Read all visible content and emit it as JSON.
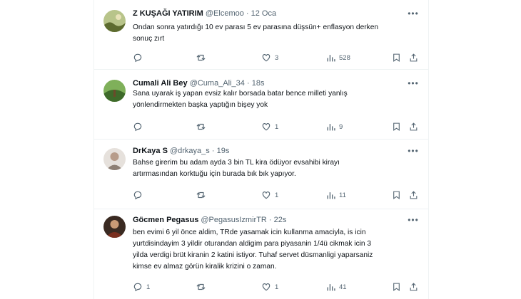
{
  "tweets": [
    {
      "name": "Z KUŞAĞI YATIRIM",
      "handle": "@Elcemoo",
      "sep": "·",
      "time": "12 Oca",
      "lines": [
        "Ondan sonra yatırdığı 10 ev parası 5 ev parasına düşsün+ enflasyon derken",
        "sonuç zırt"
      ],
      "replies": "",
      "retweets": "",
      "likes": "3",
      "views": "528",
      "avatar_color": "#8a9a5b"
    },
    {
      "name": "Cumali Ali Bey",
      "handle": "@Cuma_Ali_34",
      "sep": "·",
      "time": "18s",
      "lines": [
        "Sana uyarak iş yapan evsiz kalır borsada batar bence milleti yanlış",
        "yönlendirmekten başka yaptığın bişey yok"
      ],
      "replies": "",
      "retweets": "",
      "likes": "1",
      "views": "9",
      "avatar_color": "#4f7f3a"
    },
    {
      "name": "DrKaya S",
      "handle": "@drkaya_s",
      "sep": "·",
      "time": "19s",
      "lines": [
        "Bahse girerim bu adam ayda 3 bin TL kira ödüyor evsahibi kirayı",
        "artırmasından korktuğu için burada bık bık yapıyor."
      ],
      "replies": "",
      "retweets": "",
      "likes": "1",
      "views": "11",
      "avatar_color": "#c9c2bb"
    },
    {
      "name": "Göcmen Pegasus",
      "handle": "@PegasusIzmirTR",
      "sep": "·",
      "time": "22s",
      "lines": [
        "ben evimi 6 yil önce aldim, TRde yasamak icin kullanma amaciyla, is icin",
        "yurtdisindayim 3 yildir oturandan aldigim para piyasanin 1/4ü cikmak icin 3",
        "yilda verdigi brüt kiranin 2 katini istiyor. Tuhaf servet düsmanligi yaparsaniz",
        "kimse ev almaz görün kiralik krizini o zaman."
      ],
      "replies": "1",
      "retweets": "",
      "likes": "1",
      "views": "41",
      "avatar_color": "#5a3b2e"
    }
  ],
  "icons": {
    "more": "more-icon",
    "reply": "reply-icon",
    "retweet": "retweet-icon",
    "like": "like-icon",
    "views": "views-icon",
    "bookmark": "bookmark-icon",
    "share": "share-icon"
  },
  "colors": {
    "text": "#0f1419",
    "secondary": "#536471",
    "border": "#eff3f4"
  }
}
